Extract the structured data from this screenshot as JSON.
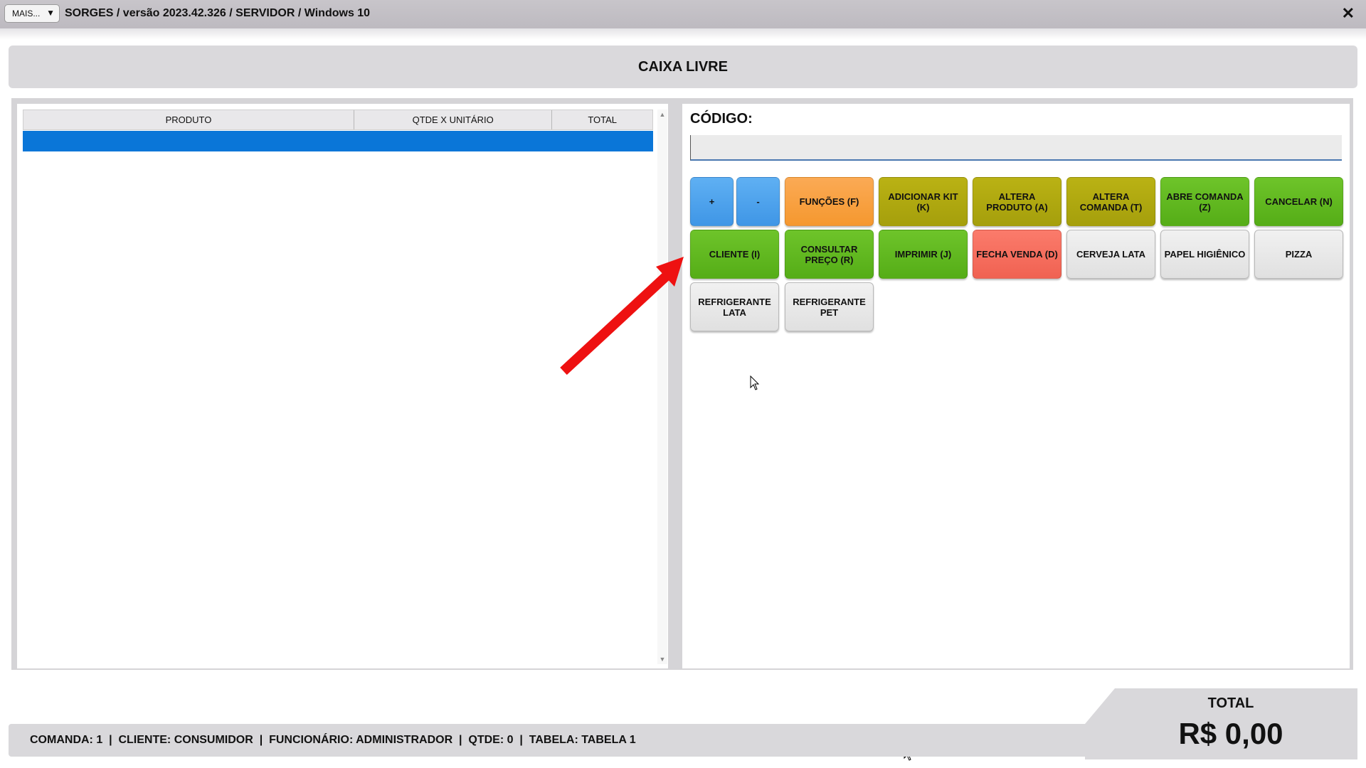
{
  "titlebar": {
    "menu_label": "MAIS...",
    "menu_arrow": "▼",
    "title": "SORGES / versão 2023.42.326 / SERVIDOR / Windows 10",
    "close": "✕"
  },
  "header": {
    "title": "CAIXA LIVRE"
  },
  "grid": {
    "columns": [
      "PRODUTO",
      "QTDE X UNITÁRIO",
      "TOTAL"
    ],
    "rows": []
  },
  "code": {
    "label": "CÓDIGO:",
    "value": ""
  },
  "buttons": [
    {
      "label": "+",
      "color": "#4da3ee"
    },
    {
      "label": "-",
      "color": "#4da3ee"
    },
    {
      "label": "FUNÇÕES (F)",
      "color": "#f8a142"
    },
    {
      "label": "ADICIONAR KIT (K)",
      "color": "#b0a910"
    },
    {
      "label": "ALTERA PRODUTO (A)",
      "color": "#b0a910"
    },
    {
      "label": "ALTERA COMANDA (T)",
      "color": "#b0a910"
    },
    {
      "label": "ABRE COMANDA (Z)",
      "color": "#62b921"
    },
    {
      "label": "CANCELAR (N)",
      "color": "#62b921"
    },
    {
      "label": "CLIENTE (I)",
      "color": "#62b921"
    },
    {
      "label": "CONSULTAR PREÇO (R)",
      "color": "#62b921"
    },
    {
      "label": "IMPRIMIR (J)",
      "color": "#62b921"
    },
    {
      "label": "FECHA VENDA (D)",
      "color": "#f56e5e"
    },
    {
      "label": "CERVEJA LATA",
      "color": "#e8e8e8"
    },
    {
      "label": "PAPEL HIGIÊNICO",
      "color": "#e8e8e8"
    },
    {
      "label": "PIZZA",
      "color": "#e8e8e8"
    },
    {
      "label": "REFRIGERANTE LATA",
      "color": "#e8e8e8"
    },
    {
      "label": "REFRIGERANTE PET",
      "color": "#e8e8e8"
    }
  ],
  "status": {
    "text": "COMANDA: 1  |  CLIENTE: CONSUMIDOR  |  FUNCIONÁRIO: ADMINISTRADOR  |  QTDE: 0  |  TABELA: TABELA 1"
  },
  "total": {
    "label": "TOTAL",
    "value": "R$ 0,00"
  },
  "annotation": {
    "arrow_color": "#ee1111"
  }
}
